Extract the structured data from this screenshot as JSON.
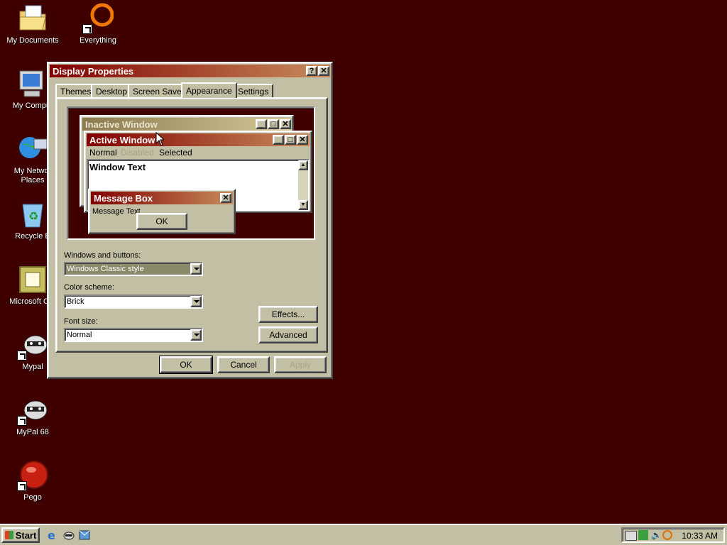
{
  "desktop": {
    "icons": [
      {
        "label": "My Documents",
        "icon": "folder-documents-icon"
      },
      {
        "label": "Everything",
        "icon": "everything-ring-icon"
      },
      {
        "label": "My Comput",
        "icon": "computer-icon"
      },
      {
        "label": "My Networ\nPlaces",
        "icon": "network-icon"
      },
      {
        "label": "Recycle B",
        "icon": "recycle-bin-icon"
      },
      {
        "label": "Microsoft Out",
        "icon": "outlook-icon"
      },
      {
        "label": "Mypal",
        "icon": "raccoon-icon"
      },
      {
        "label": "MyPal 68",
        "icon": "raccoon-icon"
      },
      {
        "label": "Pego",
        "icon": "pego-icon"
      }
    ]
  },
  "dialog": {
    "title": "Display Properties",
    "help_glyph": "?",
    "close_glyph": "✕",
    "tabs": [
      "Themes",
      "Desktop",
      "Screen Saver",
      "Appearance",
      "Settings"
    ],
    "selected_tab": "Appearance",
    "preview": {
      "inactive_title": "Inactive Window",
      "active_title": "Active Window",
      "menu": [
        "Normal",
        "Disabled",
        "Selected"
      ],
      "window_text": "Window Text",
      "message_box_title": "Message Box",
      "message_text": "Message Text",
      "ok_label": "OK"
    },
    "windows_buttons_label": "Windows and buttons:",
    "windows_buttons_value": "Windows Classic style",
    "color_scheme_label": "Color scheme:",
    "color_scheme_value": "Brick",
    "font_size_label": "Font size:",
    "font_size_value": "Normal",
    "effects_label": "Effects...",
    "advanced_label": "Advanced",
    "ok_label": "OK",
    "cancel_label": "Cancel",
    "apply_label": "Apply"
  },
  "taskbar": {
    "start_label": "Start",
    "clock": "10:33 AM"
  },
  "colors": {
    "desktop": "#3f0000",
    "face": "#c2bfa5",
    "active_title_start": "#800000",
    "active_title_end": "#c88c5c"
  }
}
